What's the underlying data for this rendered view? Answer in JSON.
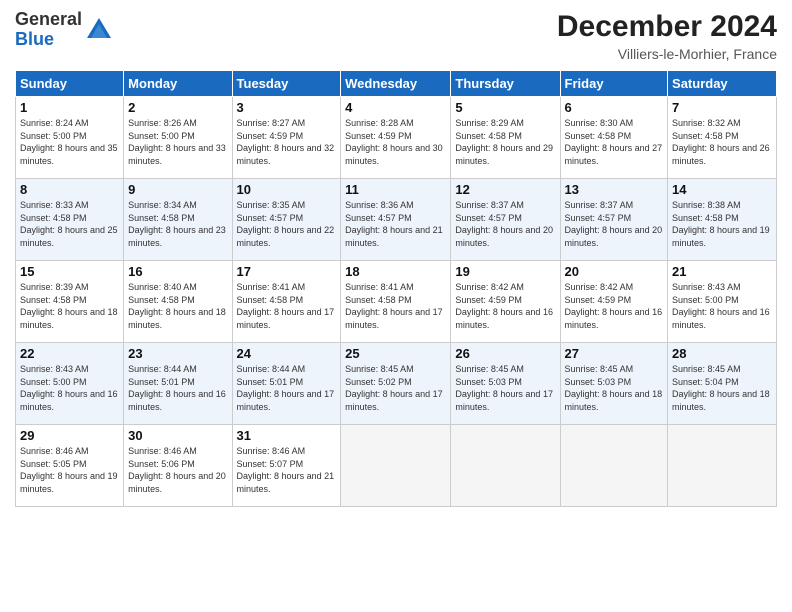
{
  "logo": {
    "general": "General",
    "blue": "Blue"
  },
  "title": "December 2024",
  "location": "Villiers-le-Morhier, France",
  "days_of_week": [
    "Sunday",
    "Monday",
    "Tuesday",
    "Wednesday",
    "Thursday",
    "Friday",
    "Saturday"
  ],
  "weeks": [
    [
      {
        "day": "1",
        "sunrise": "8:24 AM",
        "sunset": "5:00 PM",
        "daylight": "8 hours and 35 minutes."
      },
      {
        "day": "2",
        "sunrise": "8:26 AM",
        "sunset": "5:00 PM",
        "daylight": "8 hours and 33 minutes."
      },
      {
        "day": "3",
        "sunrise": "8:27 AM",
        "sunset": "4:59 PM",
        "daylight": "8 hours and 32 minutes."
      },
      {
        "day": "4",
        "sunrise": "8:28 AM",
        "sunset": "4:59 PM",
        "daylight": "8 hours and 30 minutes."
      },
      {
        "day": "5",
        "sunrise": "8:29 AM",
        "sunset": "4:58 PM",
        "daylight": "8 hours and 29 minutes."
      },
      {
        "day": "6",
        "sunrise": "8:30 AM",
        "sunset": "4:58 PM",
        "daylight": "8 hours and 27 minutes."
      },
      {
        "day": "7",
        "sunrise": "8:32 AM",
        "sunset": "4:58 PM",
        "daylight": "8 hours and 26 minutes."
      }
    ],
    [
      {
        "day": "8",
        "sunrise": "8:33 AM",
        "sunset": "4:58 PM",
        "daylight": "8 hours and 25 minutes."
      },
      {
        "day": "9",
        "sunrise": "8:34 AM",
        "sunset": "4:58 PM",
        "daylight": "8 hours and 23 minutes."
      },
      {
        "day": "10",
        "sunrise": "8:35 AM",
        "sunset": "4:57 PM",
        "daylight": "8 hours and 22 minutes."
      },
      {
        "day": "11",
        "sunrise": "8:36 AM",
        "sunset": "4:57 PM",
        "daylight": "8 hours and 21 minutes."
      },
      {
        "day": "12",
        "sunrise": "8:37 AM",
        "sunset": "4:57 PM",
        "daylight": "8 hours and 20 minutes."
      },
      {
        "day": "13",
        "sunrise": "8:37 AM",
        "sunset": "4:57 PM",
        "daylight": "8 hours and 20 minutes."
      },
      {
        "day": "14",
        "sunrise": "8:38 AM",
        "sunset": "4:58 PM",
        "daylight": "8 hours and 19 minutes."
      }
    ],
    [
      {
        "day": "15",
        "sunrise": "8:39 AM",
        "sunset": "4:58 PM",
        "daylight": "8 hours and 18 minutes."
      },
      {
        "day": "16",
        "sunrise": "8:40 AM",
        "sunset": "4:58 PM",
        "daylight": "8 hours and 18 minutes."
      },
      {
        "day": "17",
        "sunrise": "8:41 AM",
        "sunset": "4:58 PM",
        "daylight": "8 hours and 17 minutes."
      },
      {
        "day": "18",
        "sunrise": "8:41 AM",
        "sunset": "4:58 PM",
        "daylight": "8 hours and 17 minutes."
      },
      {
        "day": "19",
        "sunrise": "8:42 AM",
        "sunset": "4:59 PM",
        "daylight": "8 hours and 16 minutes."
      },
      {
        "day": "20",
        "sunrise": "8:42 AM",
        "sunset": "4:59 PM",
        "daylight": "8 hours and 16 minutes."
      },
      {
        "day": "21",
        "sunrise": "8:43 AM",
        "sunset": "5:00 PM",
        "daylight": "8 hours and 16 minutes."
      }
    ],
    [
      {
        "day": "22",
        "sunrise": "8:43 AM",
        "sunset": "5:00 PM",
        "daylight": "8 hours and 16 minutes."
      },
      {
        "day": "23",
        "sunrise": "8:44 AM",
        "sunset": "5:01 PM",
        "daylight": "8 hours and 16 minutes."
      },
      {
        "day": "24",
        "sunrise": "8:44 AM",
        "sunset": "5:01 PM",
        "daylight": "8 hours and 17 minutes."
      },
      {
        "day": "25",
        "sunrise": "8:45 AM",
        "sunset": "5:02 PM",
        "daylight": "8 hours and 17 minutes."
      },
      {
        "day": "26",
        "sunrise": "8:45 AM",
        "sunset": "5:03 PM",
        "daylight": "8 hours and 17 minutes."
      },
      {
        "day": "27",
        "sunrise": "8:45 AM",
        "sunset": "5:03 PM",
        "daylight": "8 hours and 18 minutes."
      },
      {
        "day": "28",
        "sunrise": "8:45 AM",
        "sunset": "5:04 PM",
        "daylight": "8 hours and 18 minutes."
      }
    ],
    [
      {
        "day": "29",
        "sunrise": "8:46 AM",
        "sunset": "5:05 PM",
        "daylight": "8 hours and 19 minutes."
      },
      {
        "day": "30",
        "sunrise": "8:46 AM",
        "sunset": "5:06 PM",
        "daylight": "8 hours and 20 minutes."
      },
      {
        "day": "31",
        "sunrise": "8:46 AM",
        "sunset": "5:07 PM",
        "daylight": "8 hours and 21 minutes."
      },
      null,
      null,
      null,
      null
    ]
  ]
}
